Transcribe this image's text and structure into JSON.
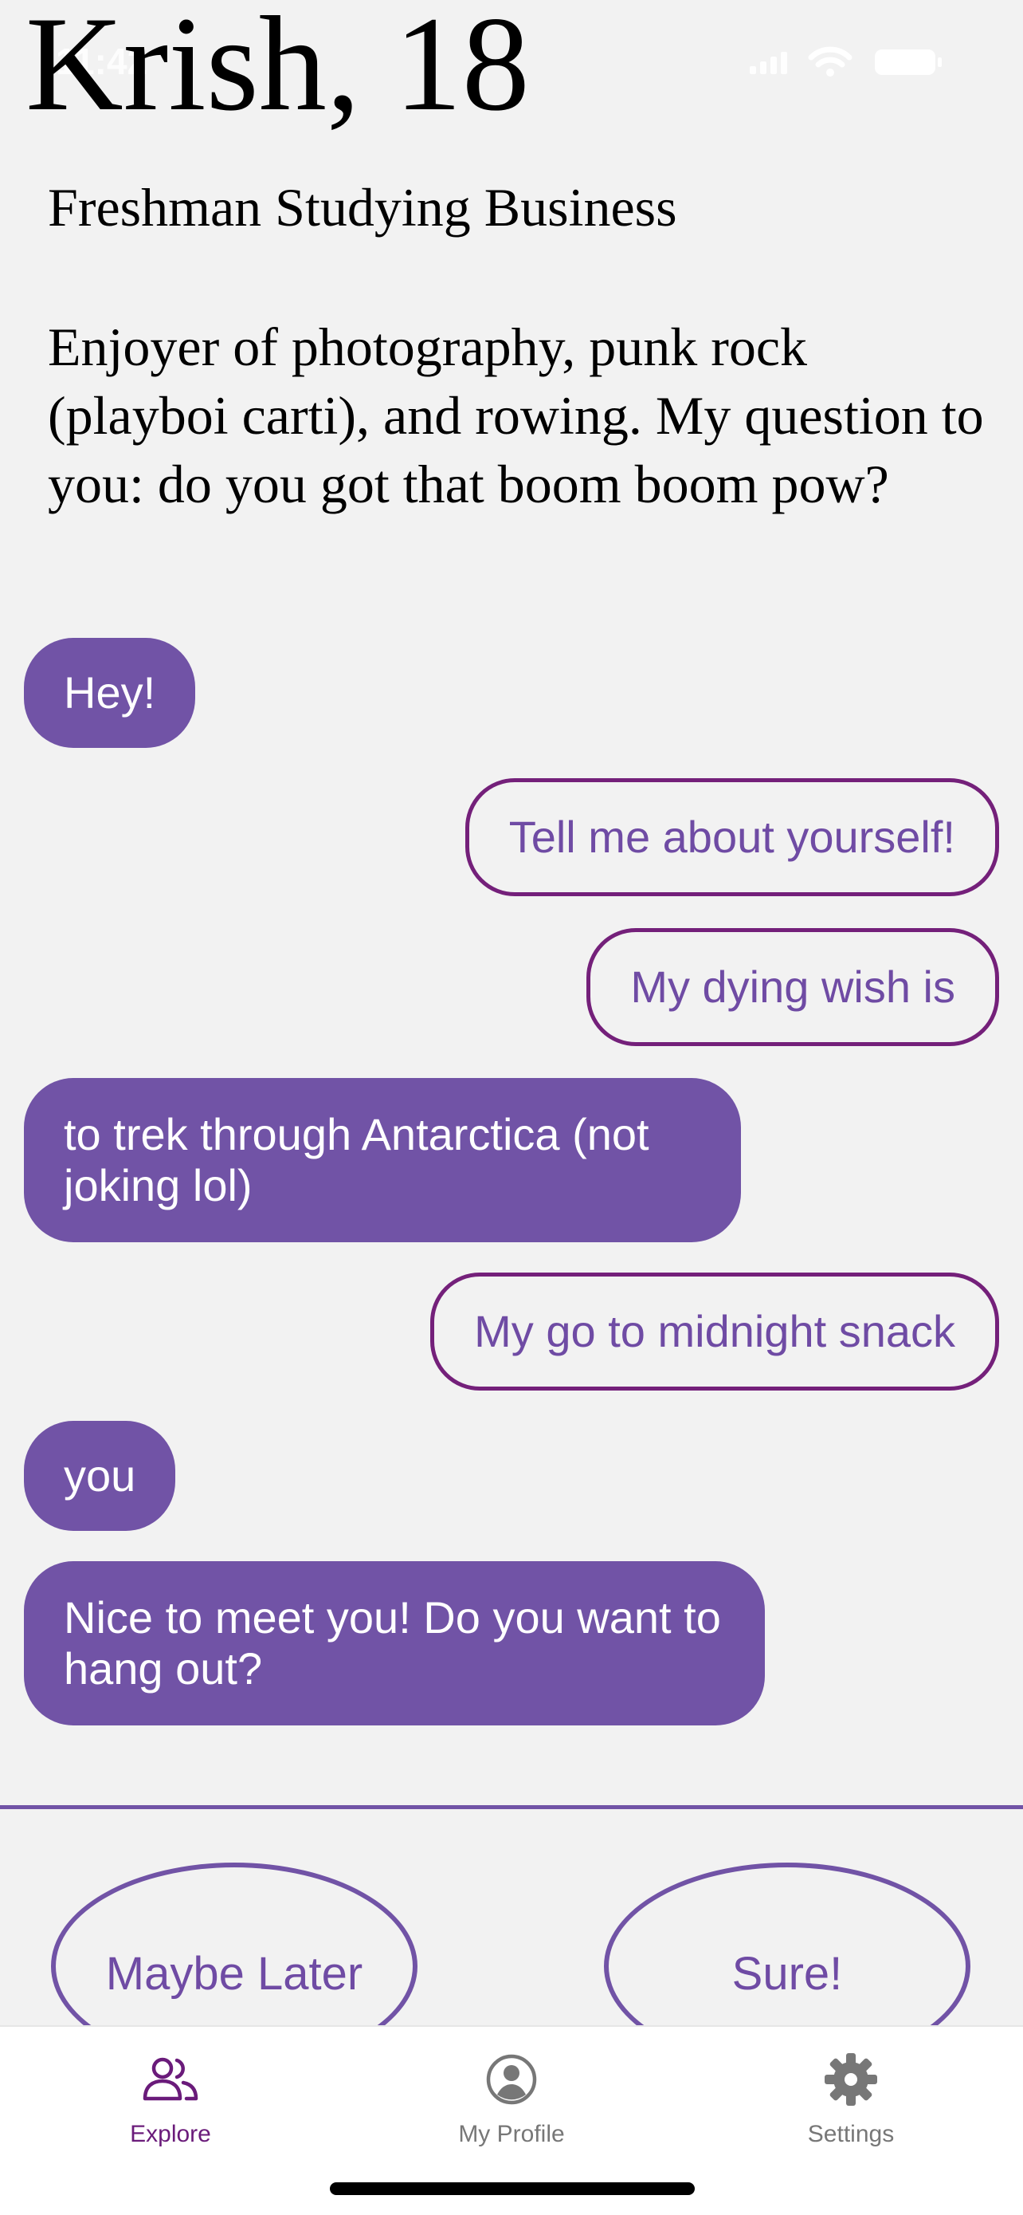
{
  "status_bar": {
    "time": "11:42"
  },
  "profile": {
    "name_age": "Krish, 18",
    "subtitle": "Freshman Studying Business",
    "bio": "Enjoyer of photography, punk rock (playboi carti), and rowing. My question to you: do you got that boom boom pow?"
  },
  "messages": [
    {
      "side": "left",
      "text": "Hey!"
    },
    {
      "side": "right",
      "text": "Tell me about yourself!"
    },
    {
      "side": "right",
      "text": "My dying wish is"
    },
    {
      "side": "left",
      "text": "to trek through Antarctica (not joking lol)"
    },
    {
      "side": "right",
      "text": "My go to midnight snack"
    },
    {
      "side": "left",
      "text": "you"
    },
    {
      "side": "left",
      "text": "Nice to meet you! Do you want to hang out?"
    }
  ],
  "actions": {
    "maybe_later": "Maybe Later",
    "sure": "Sure!"
  },
  "tabs": [
    {
      "label": "Explore",
      "icon": "people-icon",
      "active": true
    },
    {
      "label": "My Profile",
      "icon": "profile-icon",
      "active": false
    },
    {
      "label": "Settings",
      "icon": "gear-icon",
      "active": false
    }
  ],
  "colors": {
    "accent": "#7153a6",
    "outline": "#74207a",
    "tab_active": "#6a1b7a",
    "tab_inactive": "#777777"
  }
}
